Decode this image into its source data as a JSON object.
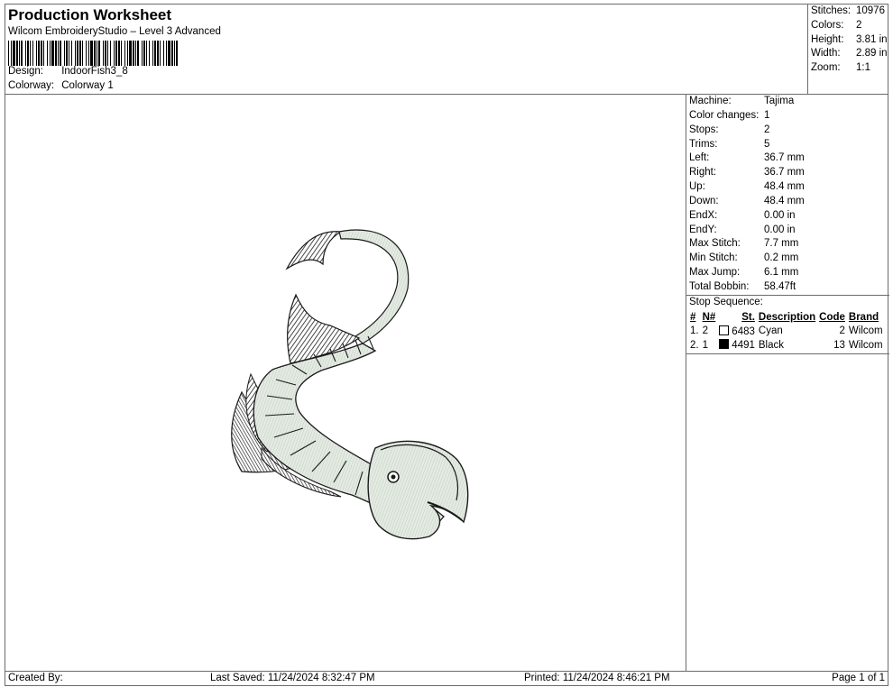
{
  "header": {
    "title": "Production Worksheet",
    "subtitle": "Wilcom EmbroideryStudio – Level 3 Advanced",
    "design_label": "Design:",
    "design_value": "IndoorFish3_8",
    "colorway_label": "Colorway:",
    "colorway_value": "Colorway 1"
  },
  "summary": [
    {
      "label": "Stitches:",
      "value": "10976"
    },
    {
      "label": "Colors:",
      "value": "2"
    },
    {
      "label": "Height:",
      "value": "3.81 in"
    },
    {
      "label": "Width:",
      "value": "2.89 in"
    },
    {
      "label": "Zoom:",
      "value": "1:1"
    }
  ],
  "details": [
    {
      "label": "Machine:",
      "value": "Tajima"
    },
    {
      "label": "Color changes:",
      "value": "1"
    },
    {
      "label": "Stops:",
      "value": "2"
    },
    {
      "label": "Trims:",
      "value": "5"
    },
    {
      "label": "Left:",
      "value": "36.7 mm"
    },
    {
      "label": "Right:",
      "value": "36.7 mm"
    },
    {
      "label": "Up:",
      "value": "48.4 mm"
    },
    {
      "label": "Down:",
      "value": "48.4 mm"
    },
    {
      "label": "EndX:",
      "value": "0.00 in"
    },
    {
      "label": "EndY:",
      "value": "0.00 in"
    },
    {
      "label": "Max Stitch:",
      "value": "7.7 mm"
    },
    {
      "label": "Min Stitch:",
      "value": "0.2 mm"
    },
    {
      "label": "Max Jump:",
      "value": "6.1 mm"
    },
    {
      "label": "Total Bobbin:",
      "value": "58.47ft"
    }
  ],
  "stop_sequence": {
    "title": "Stop Sequence:",
    "headers": {
      "num": "#",
      "n": "N#",
      "st": "St.",
      "description": "Description",
      "code": "Code",
      "brand": "Brand"
    },
    "rows": [
      {
        "num": "1.",
        "n": "2",
        "swatch": "#ffffff",
        "st": "6483",
        "description": "Cyan",
        "code": "2",
        "brand": "Wilcom"
      },
      {
        "num": "2.",
        "n": "1",
        "swatch": "#000000",
        "st": "4491",
        "description": "Black",
        "code": "13",
        "brand": "Wilcom"
      }
    ]
  },
  "footer": {
    "created_by": "Created By:",
    "last_saved": "Last Saved: 11/24/2024 8:32:47 PM",
    "printed": "Printed: 11/24/2024 8:46:21 PM",
    "page": "Page 1 of 1"
  },
  "design_preview": {
    "icon": "fish-embroidery-icon",
    "fill_color": "#e4ebe3",
    "stroke_color": "#1a1a1a"
  }
}
